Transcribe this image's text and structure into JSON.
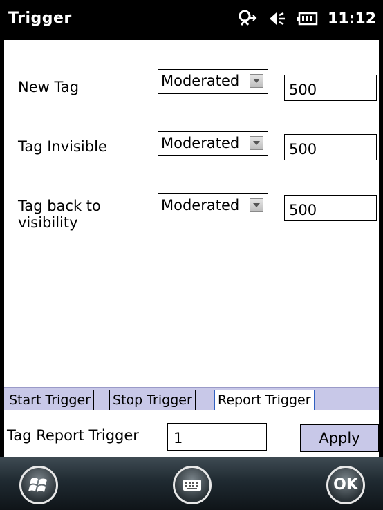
{
  "status_bar": {
    "title": "Trigger",
    "time": "11:12",
    "icons": [
      "connectivity-icon",
      "volume-icon",
      "battery-icon"
    ]
  },
  "rows": [
    {
      "label": "New Tag",
      "mode": "Moderated",
      "value": "500"
    },
    {
      "label": "Tag Invisible",
      "mode": "Moderated",
      "value": "500"
    },
    {
      "label_line1": "Tag back to",
      "label_line2": "visibility",
      "mode": "Moderated",
      "value": "500"
    }
  ],
  "tabs": [
    {
      "label": "Start Trigger",
      "active": false
    },
    {
      "label": "Stop Trigger",
      "active": false
    },
    {
      "label": "Report Trigger",
      "active": true
    }
  ],
  "footer": {
    "label": "Tag Report Trigger",
    "value": "1",
    "apply_label": "Apply"
  },
  "softkeys": {
    "left": "windows-start-icon",
    "center": "keyboard-icon",
    "right_label": "OK"
  },
  "colors": {
    "tab_background": "#c8c8e8",
    "active_tab_border": "#3060c0",
    "softkey_bar": "#1f2a31"
  }
}
